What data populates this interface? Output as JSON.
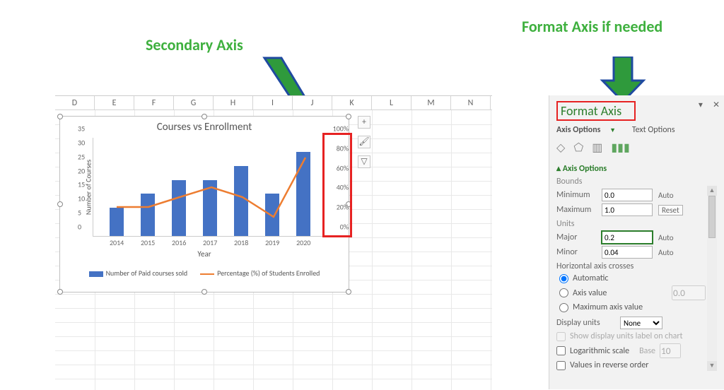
{
  "annotations": {
    "left_label": "Secondary Axis",
    "right_label": "Format Axis if needed"
  },
  "columns": [
    "D",
    "E",
    "F",
    "G",
    "H",
    "I",
    "J",
    "K",
    "L",
    "M",
    "N"
  ],
  "chart_tools": {
    "add": "+",
    "brush": "🖌",
    "filter": "▽"
  },
  "chart_data": {
    "type": "bar",
    "title": "Courses vs Enrollment",
    "xlabel": "Year",
    "ylabel": "Number of Courses",
    "categories": [
      "2014",
      "2015",
      "2016",
      "2017",
      "2018",
      "2019",
      "2020"
    ],
    "y_ticks": [
      0,
      5,
      10,
      15,
      20,
      25,
      30,
      35
    ],
    "y2_ticks_raw": [
      0,
      0.2,
      0.4,
      0.6,
      0.8,
      1.0
    ],
    "y2_ticks_display": [
      "0%",
      "20%",
      "40%",
      "60%",
      "80%",
      "100%"
    ],
    "ylim": [
      0,
      35
    ],
    "y2lim": [
      0,
      1.0
    ],
    "series": [
      {
        "name": "Number of Paid courses sold",
        "type": "bar",
        "color": "#4472c4",
        "values": [
          10,
          15,
          20,
          20,
          25,
          15,
          30
        ]
      },
      {
        "name": "Percentage (%) of Students Enrolled",
        "type": "line",
        "color": "#ed7d31",
        "values": [
          0.3,
          0.3,
          0.4,
          0.5,
          0.4,
          0.2,
          0.8
        ]
      }
    ]
  },
  "format_axis": {
    "title": "Format Axis",
    "tabs": {
      "axis_options": "Axis Options",
      "text_options": "Text Options"
    },
    "section": "Axis Options",
    "bounds_label": "Bounds",
    "minimum_label": "Minimum",
    "minimum_value": "0.0",
    "minimum_btn": "Auto",
    "maximum_label": "Maximum",
    "maximum_value": "1.0",
    "maximum_btn": "Reset",
    "units_label": "Units",
    "major_label": "Major",
    "major_value": "0.2",
    "major_btn": "Auto",
    "minor_label": "Minor",
    "minor_value": "0.04",
    "minor_btn": "Auto",
    "hax_crosses": "Horizontal axis crosses",
    "radio_auto": "Automatic",
    "radio_axis_value": "Axis value",
    "axis_value_placeholder": "0.0",
    "radio_max": "Maximum axis value",
    "display_units_label": "Display units",
    "display_units_value": "None",
    "show_units_label": "Show display units label on chart",
    "log_label": "Logarithmic scale",
    "log_base_label": "Base",
    "log_base_value": "10",
    "reverse_label": "Values in reverse order"
  }
}
